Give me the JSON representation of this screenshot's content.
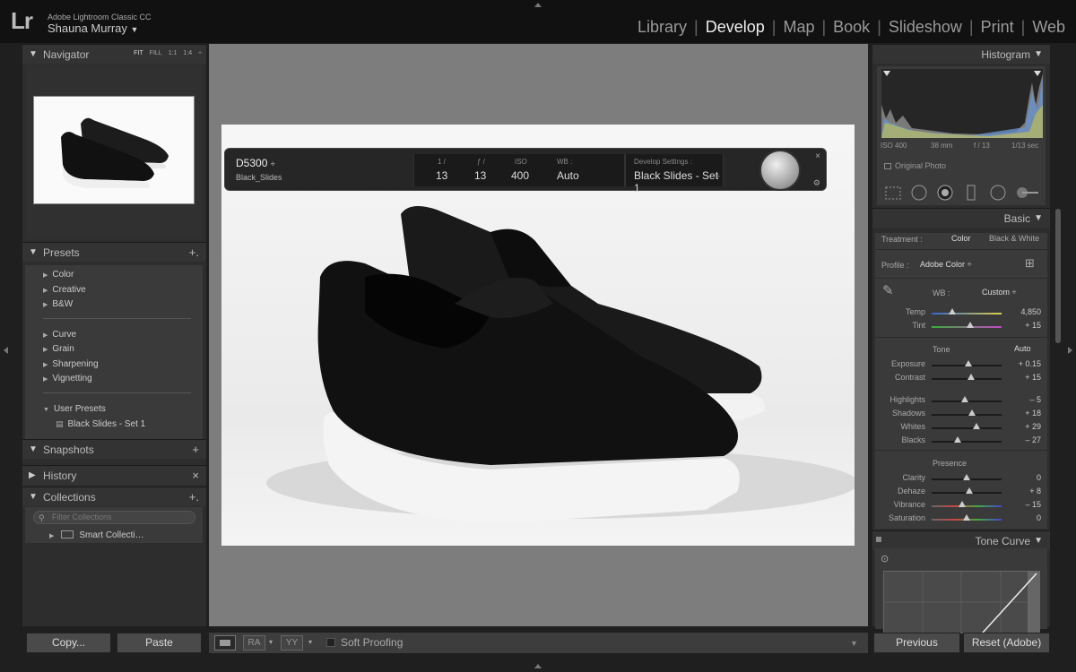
{
  "app": {
    "logo": "Lr",
    "name": "Adobe Lightroom Classic CC",
    "user": "Shauna Murray",
    "user_caret": "▼"
  },
  "modules": [
    {
      "label": "Library"
    },
    {
      "label": "Develop"
    },
    {
      "label": "Map"
    },
    {
      "label": "Book"
    },
    {
      "label": "Slideshow"
    },
    {
      "label": "Print"
    },
    {
      "label": "Web"
    }
  ],
  "active_module": "Develop",
  "left_panel": {
    "navigator": {
      "title": "Navigator",
      "opts": [
        "FIT",
        "FILL",
        "1:1",
        "1:4"
      ],
      "opt_caret": "÷"
    },
    "presets": {
      "title": "Presets",
      "add": "+.",
      "groups1": [
        "Color",
        "Creative",
        "B&W"
      ],
      "groups2": [
        "Curve",
        "Grain",
        "Sharpening",
        "Vignetting"
      ],
      "user_presets": "User Presets",
      "user_item": "Black Slides - Set 1"
    },
    "snapshots": {
      "title": "Snapshots",
      "add": "+"
    },
    "history": {
      "title": "History",
      "clear": "×"
    },
    "collections": {
      "title": "Collections",
      "add": "+.",
      "search_placeholder": "Filter Collections",
      "smart": "Smart Collecti…"
    },
    "copy_label": "Copy...",
    "paste_label": "Paste"
  },
  "hud": {
    "camera": "D5300",
    "camera_caret": "÷",
    "preset": "Black_Slides",
    "shutter_label": "1 /",
    "shutter_value": "13",
    "aperture_label": "ƒ /",
    "aperture_value": "13",
    "iso_label": "ISO",
    "iso_value": "400",
    "wb_label": "WB :",
    "wb_value": "Auto",
    "dev_label": "Develop Settings :",
    "dev_value": "Black Slides - Set 1",
    "dev_caret": "÷",
    "close": "×",
    "gear": "⚙"
  },
  "toolbar": {
    "ra": "RA",
    "yy": "YY",
    "caret": "▾",
    "soft_proofing": "Soft Proofing",
    "drop": "▼"
  },
  "right_panel": {
    "histogram": {
      "title": "Histogram",
      "iso": "ISO 400",
      "focal": "38 mm",
      "fstop": "f / 13",
      "shutter": "1/13 sec",
      "original_photo": "Original Photo"
    },
    "basic": {
      "title": "Basic",
      "treatment_label": "Treatment :",
      "treatment_color": "Color",
      "treatment_bw": "Black & White",
      "profile_label": "Profile :",
      "profile_value": "Adobe Color",
      "profile_caret": "÷",
      "wb_label": "WB :",
      "wb_value": "Custom",
      "wb_caret": "÷",
      "tone_label": "Tone",
      "auto_label": "Auto",
      "presence_label": "Presence",
      "sliders_wb": [
        {
          "label": "Temp",
          "value": "4,850",
          "pos": 0.3
        },
        {
          "label": "Tint",
          "value": "+ 15",
          "pos": 0.55
        }
      ],
      "sliders_tone1": [
        {
          "label": "Exposure",
          "value": "+ 0.15",
          "pos": 0.52
        },
        {
          "label": "Contrast",
          "value": "+ 15",
          "pos": 0.56
        }
      ],
      "sliders_tone2": [
        {
          "label": "Highlights",
          "value": "– 5",
          "pos": 0.47
        },
        {
          "label": "Shadows",
          "value": "+ 18",
          "pos": 0.58
        },
        {
          "label": "Whites",
          "value": "+ 29",
          "pos": 0.64
        },
        {
          "label": "Blacks",
          "value": "– 27",
          "pos": 0.37
        }
      ],
      "sliders_presence": [
        {
          "label": "Clarity",
          "value": "0",
          "pos": 0.5
        },
        {
          "label": "Dehaze",
          "value": "+ 8",
          "pos": 0.54
        },
        {
          "label": "Vibrance",
          "value": "– 15",
          "pos": 0.43
        },
        {
          "label": "Saturation",
          "value": "0",
          "pos": 0.5
        }
      ]
    },
    "tone_curve": {
      "title": "Tone Curve"
    },
    "previous_label": "Previous",
    "reset_label": "Reset (Adobe)"
  }
}
